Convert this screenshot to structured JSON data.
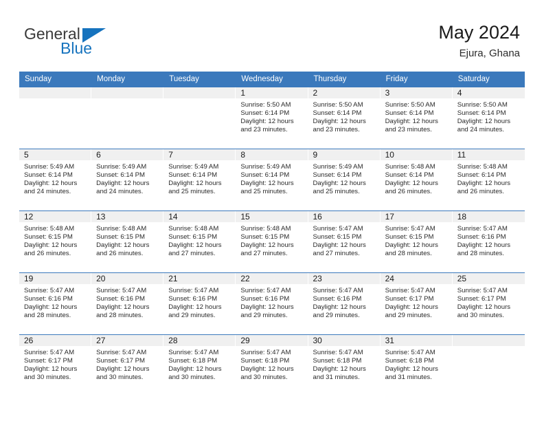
{
  "brand": {
    "name_part1": "General",
    "name_part2": "Blue"
  },
  "header": {
    "title": "May 2024",
    "subtitle": "Ejura, Ghana"
  },
  "colors": {
    "header_blue": "#3B79BC",
    "brand_blue": "#1673be",
    "day_band_gray": "#f0f0f0"
  },
  "weekdays": [
    "Sunday",
    "Monday",
    "Tuesday",
    "Wednesday",
    "Thursday",
    "Friday",
    "Saturday"
  ],
  "weeks": [
    [
      {
        "day": "",
        "empty": true
      },
      {
        "day": "",
        "empty": true
      },
      {
        "day": "",
        "empty": true
      },
      {
        "day": "1",
        "sunrise": "Sunrise: 5:50 AM",
        "sunset": "Sunset: 6:14 PM",
        "daylight1": "Daylight: 12 hours",
        "daylight2": "and 23 minutes."
      },
      {
        "day": "2",
        "sunrise": "Sunrise: 5:50 AM",
        "sunset": "Sunset: 6:14 PM",
        "daylight1": "Daylight: 12 hours",
        "daylight2": "and 23 minutes."
      },
      {
        "day": "3",
        "sunrise": "Sunrise: 5:50 AM",
        "sunset": "Sunset: 6:14 PM",
        "daylight1": "Daylight: 12 hours",
        "daylight2": "and 23 minutes."
      },
      {
        "day": "4",
        "sunrise": "Sunrise: 5:50 AM",
        "sunset": "Sunset: 6:14 PM",
        "daylight1": "Daylight: 12 hours",
        "daylight2": "and 24 minutes."
      }
    ],
    [
      {
        "day": "5",
        "sunrise": "Sunrise: 5:49 AM",
        "sunset": "Sunset: 6:14 PM",
        "daylight1": "Daylight: 12 hours",
        "daylight2": "and 24 minutes."
      },
      {
        "day": "6",
        "sunrise": "Sunrise: 5:49 AM",
        "sunset": "Sunset: 6:14 PM",
        "daylight1": "Daylight: 12 hours",
        "daylight2": "and 24 minutes."
      },
      {
        "day": "7",
        "sunrise": "Sunrise: 5:49 AM",
        "sunset": "Sunset: 6:14 PM",
        "daylight1": "Daylight: 12 hours",
        "daylight2": "and 25 minutes."
      },
      {
        "day": "8",
        "sunrise": "Sunrise: 5:49 AM",
        "sunset": "Sunset: 6:14 PM",
        "daylight1": "Daylight: 12 hours",
        "daylight2": "and 25 minutes."
      },
      {
        "day": "9",
        "sunrise": "Sunrise: 5:49 AM",
        "sunset": "Sunset: 6:14 PM",
        "daylight1": "Daylight: 12 hours",
        "daylight2": "and 25 minutes."
      },
      {
        "day": "10",
        "sunrise": "Sunrise: 5:48 AM",
        "sunset": "Sunset: 6:14 PM",
        "daylight1": "Daylight: 12 hours",
        "daylight2": "and 26 minutes."
      },
      {
        "day": "11",
        "sunrise": "Sunrise: 5:48 AM",
        "sunset": "Sunset: 6:14 PM",
        "daylight1": "Daylight: 12 hours",
        "daylight2": "and 26 minutes."
      }
    ],
    [
      {
        "day": "12",
        "sunrise": "Sunrise: 5:48 AM",
        "sunset": "Sunset: 6:15 PM",
        "daylight1": "Daylight: 12 hours",
        "daylight2": "and 26 minutes."
      },
      {
        "day": "13",
        "sunrise": "Sunrise: 5:48 AM",
        "sunset": "Sunset: 6:15 PM",
        "daylight1": "Daylight: 12 hours",
        "daylight2": "and 26 minutes."
      },
      {
        "day": "14",
        "sunrise": "Sunrise: 5:48 AM",
        "sunset": "Sunset: 6:15 PM",
        "daylight1": "Daylight: 12 hours",
        "daylight2": "and 27 minutes."
      },
      {
        "day": "15",
        "sunrise": "Sunrise: 5:48 AM",
        "sunset": "Sunset: 6:15 PM",
        "daylight1": "Daylight: 12 hours",
        "daylight2": "and 27 minutes."
      },
      {
        "day": "16",
        "sunrise": "Sunrise: 5:47 AM",
        "sunset": "Sunset: 6:15 PM",
        "daylight1": "Daylight: 12 hours",
        "daylight2": "and 27 minutes."
      },
      {
        "day": "17",
        "sunrise": "Sunrise: 5:47 AM",
        "sunset": "Sunset: 6:15 PM",
        "daylight1": "Daylight: 12 hours",
        "daylight2": "and 28 minutes."
      },
      {
        "day": "18",
        "sunrise": "Sunrise: 5:47 AM",
        "sunset": "Sunset: 6:16 PM",
        "daylight1": "Daylight: 12 hours",
        "daylight2": "and 28 minutes."
      }
    ],
    [
      {
        "day": "19",
        "sunrise": "Sunrise: 5:47 AM",
        "sunset": "Sunset: 6:16 PM",
        "daylight1": "Daylight: 12 hours",
        "daylight2": "and 28 minutes."
      },
      {
        "day": "20",
        "sunrise": "Sunrise: 5:47 AM",
        "sunset": "Sunset: 6:16 PM",
        "daylight1": "Daylight: 12 hours",
        "daylight2": "and 28 minutes."
      },
      {
        "day": "21",
        "sunrise": "Sunrise: 5:47 AM",
        "sunset": "Sunset: 6:16 PM",
        "daylight1": "Daylight: 12 hours",
        "daylight2": "and 29 minutes."
      },
      {
        "day": "22",
        "sunrise": "Sunrise: 5:47 AM",
        "sunset": "Sunset: 6:16 PM",
        "daylight1": "Daylight: 12 hours",
        "daylight2": "and 29 minutes."
      },
      {
        "day": "23",
        "sunrise": "Sunrise: 5:47 AM",
        "sunset": "Sunset: 6:16 PM",
        "daylight1": "Daylight: 12 hours",
        "daylight2": "and 29 minutes."
      },
      {
        "day": "24",
        "sunrise": "Sunrise: 5:47 AM",
        "sunset": "Sunset: 6:17 PM",
        "daylight1": "Daylight: 12 hours",
        "daylight2": "and 29 minutes."
      },
      {
        "day": "25",
        "sunrise": "Sunrise: 5:47 AM",
        "sunset": "Sunset: 6:17 PM",
        "daylight1": "Daylight: 12 hours",
        "daylight2": "and 30 minutes."
      }
    ],
    [
      {
        "day": "26",
        "sunrise": "Sunrise: 5:47 AM",
        "sunset": "Sunset: 6:17 PM",
        "daylight1": "Daylight: 12 hours",
        "daylight2": "and 30 minutes."
      },
      {
        "day": "27",
        "sunrise": "Sunrise: 5:47 AM",
        "sunset": "Sunset: 6:17 PM",
        "daylight1": "Daylight: 12 hours",
        "daylight2": "and 30 minutes."
      },
      {
        "day": "28",
        "sunrise": "Sunrise: 5:47 AM",
        "sunset": "Sunset: 6:18 PM",
        "daylight1": "Daylight: 12 hours",
        "daylight2": "and 30 minutes."
      },
      {
        "day": "29",
        "sunrise": "Sunrise: 5:47 AM",
        "sunset": "Sunset: 6:18 PM",
        "daylight1": "Daylight: 12 hours",
        "daylight2": "and 30 minutes."
      },
      {
        "day": "30",
        "sunrise": "Sunrise: 5:47 AM",
        "sunset": "Sunset: 6:18 PM",
        "daylight1": "Daylight: 12 hours",
        "daylight2": "and 31 minutes."
      },
      {
        "day": "31",
        "sunrise": "Sunrise: 5:47 AM",
        "sunset": "Sunset: 6:18 PM",
        "daylight1": "Daylight: 12 hours",
        "daylight2": "and 31 minutes."
      },
      {
        "day": "",
        "empty": true
      }
    ]
  ]
}
